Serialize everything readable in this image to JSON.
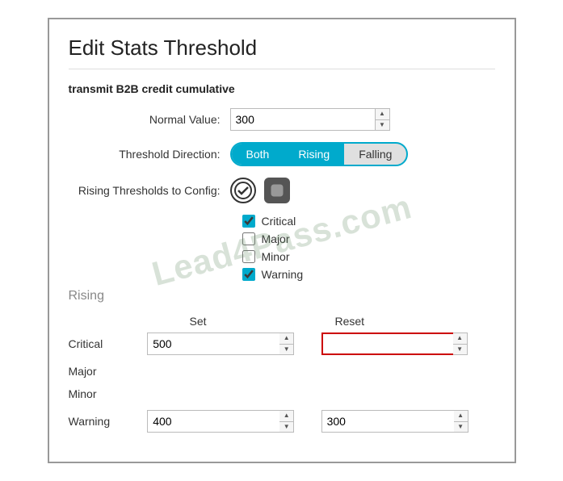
{
  "dialog": {
    "title": "Edit Stats Threshold",
    "subtitle": "transmit B2B credit cumulative"
  },
  "form": {
    "normal_value_label": "Normal Value:",
    "normal_value": "300",
    "threshold_direction_label": "Threshold Direction:",
    "threshold_buttons": [
      {
        "label": "Both",
        "active": true
      },
      {
        "label": "Rising",
        "active": true
      },
      {
        "label": "Falling",
        "active": false
      }
    ],
    "rising_thresholds_label": "Rising Thresholds to Config:",
    "checkboxes": [
      {
        "label": "Critical",
        "checked": true
      },
      {
        "label": "Major",
        "checked": false
      },
      {
        "label": "Minor",
        "checked": false
      },
      {
        "label": "Warning",
        "checked": true
      }
    ]
  },
  "rising_section": {
    "heading": "Rising",
    "set_header": "Set",
    "reset_header": "Reset",
    "rows": [
      {
        "label": "Critical",
        "set_value": "500",
        "reset_value": "",
        "reset_error": true
      },
      {
        "label": "Major",
        "set_value": "",
        "reset_value": ""
      },
      {
        "label": "Minor",
        "set_value": "",
        "reset_value": ""
      },
      {
        "label": "Warning",
        "set_value": "400",
        "reset_value": "300"
      }
    ]
  },
  "watermark": "Lead4Pass.com"
}
